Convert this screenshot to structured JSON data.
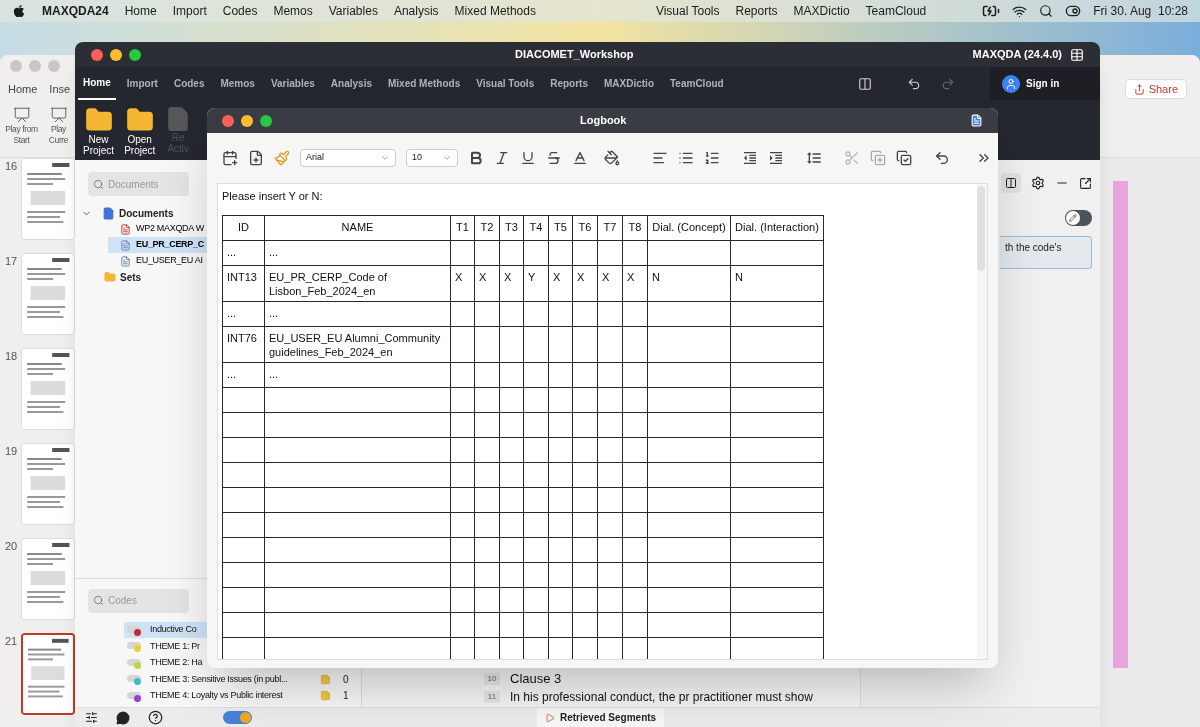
{
  "menu_bar": {
    "app": "MAXQDA24",
    "items": [
      "Home",
      "Import",
      "Codes",
      "Memos",
      "Variables",
      "Analysis",
      "Mixed Methods"
    ],
    "right_items": [
      "Visual Tools",
      "Reports",
      "MAXDictio",
      "TeamCloud"
    ],
    "clock": "Fri 30. Aug  10:28"
  },
  "background_app": {
    "tabs": [
      "Home",
      "Inse"
    ],
    "buttons": [
      "Play from Start",
      "Play Curre"
    ],
    "share": "Share",
    "slides": [
      {
        "number": "16",
        "selected": false
      },
      {
        "number": "17",
        "selected": false
      },
      {
        "number": "18",
        "selected": false
      },
      {
        "number": "19",
        "selected": false
      },
      {
        "number": "20",
        "selected": false
      },
      {
        "number": "21",
        "selected": true
      }
    ]
  },
  "main_window": {
    "title": "DIACOMET_Workshop",
    "version": "MAXQDA (24.4.0)",
    "sign_in": "Sign in",
    "tabs": [
      {
        "label": "Home",
        "selected": true
      },
      {
        "label": "Import",
        "selected": false
      },
      {
        "label": "Codes",
        "selected": false
      },
      {
        "label": "Memos",
        "selected": false
      },
      {
        "label": "Variables",
        "selected": false
      },
      {
        "label": "Analysis",
        "selected": false
      },
      {
        "label": "Mixed Methods",
        "selected": false
      },
      {
        "label": "Visual Tools",
        "selected": false
      },
      {
        "label": "Reports",
        "selected": false
      },
      {
        "label": "MAXDictio",
        "selected": false
      },
      {
        "label": "TeamCloud",
        "selected": false
      }
    ],
    "toolbar": [
      {
        "kind": "new",
        "lines": [
          "New",
          "Project"
        ],
        "disabled": false
      },
      {
        "kind": "open",
        "lines": [
          "Open",
          "Project"
        ],
        "disabled": false
      },
      {
        "kind": "activate",
        "lines": [
          "Re",
          "Activ"
        ],
        "disabled": true
      }
    ],
    "documents": {
      "search_placeholder": "Documents",
      "root": {
        "label": "Documents",
        "expanded": true,
        "children": [
          {
            "label": "WP2 MAXQDA W",
            "kind": "pdf",
            "selected": false
          },
          {
            "label": "EU_PR_CERP_C",
            "kind": "text",
            "selected": true
          },
          {
            "label": "EU_USER_EU AI",
            "kind": "text",
            "selected": false
          }
        ]
      },
      "sets": "Sets"
    },
    "codes": {
      "search_placeholder": "Codes",
      "items": [
        {
          "label": "Inductive Co",
          "color": "#c62a32",
          "selected": true
        },
        {
          "label": "THEME 1: Pr",
          "color": "#e6d42c",
          "selected": false
        },
        {
          "label": "THEME 2: Ha",
          "color": "#b6dc3c",
          "selected": false
        },
        {
          "label": "THEME 3: Sensitive Issues (in publ...",
          "color": "#3bbccc",
          "selected": false,
          "count": "0"
        },
        {
          "label": "THEME 4: Loyalty vs Public interest",
          "color": "#9a3fd0",
          "selected": false,
          "count": "1"
        }
      ]
    },
    "document_lines": [
      {
        "number": "10",
        "text": "Clause 3",
        "kind": "heading"
      },
      {
        "number": "11",
        "text": "In his professional conduct, the pr practitioner must show",
        "kind": "body"
      }
    ],
    "memo_text": "th the code's",
    "edit_toggle": {
      "on": false
    },
    "mode_switch": {
      "on": true
    },
    "status_button": "Retrieved Segments"
  },
  "logbook": {
    "title": "Logbook",
    "font": "Arial",
    "size": "10",
    "intro": "Please insert Y or N:",
    "columns": [
      "ID",
      "NAME",
      "T1",
      "T2",
      "T3",
      "T4",
      "T5",
      "T6",
      "T7",
      "T8",
      "Dial. (Concept)",
      "Dial. (Interaction)"
    ],
    "rows": [
      {
        "id": "...",
        "name": "..."
      },
      {
        "id": "INT13",
        "name": "EU_PR_CERP_Code of Lisbon_Feb_2024_en",
        "t": [
          "X",
          "X",
          "X",
          "Y",
          "X",
          "X",
          "X",
          "X"
        ],
        "dial_concept": "N",
        "dial_interaction": "N"
      },
      {
        "id": "...",
        "name": "..."
      },
      {
        "id": "INT76",
        "name": "EU_USER_EU Alumni_Community guidelines_Feb_2024_en"
      },
      {
        "id": "...",
        "name": "..."
      }
    ]
  }
}
